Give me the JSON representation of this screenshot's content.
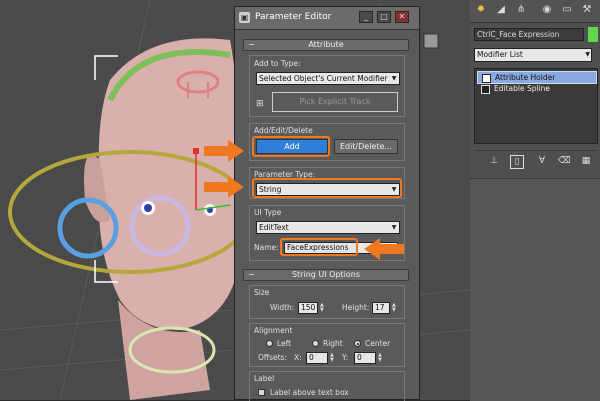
{
  "window": {
    "title": "Parameter Editor",
    "minimize": "_",
    "maximize": "□",
    "close": "✕"
  },
  "attribute": {
    "header": "Attribute",
    "collapse_sign": "−",
    "add_to_type_label": "Add to Type:",
    "add_to_type_value": "Selected Object's Current Modifier",
    "pick_explicit_track": "Pick Explicit Track"
  },
  "add_edit_delete": {
    "label": "Add/Edit/Delete",
    "add_button": "Add",
    "edit_delete_button": "Edit/Delete..."
  },
  "parameter_type": {
    "label": "Parameter Type:",
    "value": "String"
  },
  "ui_type": {
    "label": "UI Type",
    "value": "EditText",
    "name_label": "Name:",
    "name_value": "FaceExpressions"
  },
  "string_ui_options": {
    "header": "String UI Options",
    "collapse_sign": "−",
    "size_label": "Size",
    "width_label": "Width:",
    "width_value": "150",
    "height_label": "Height:",
    "height_value": "17",
    "alignment_label": "Alignment",
    "left": "Left",
    "right": "Right",
    "center": "Center",
    "selected_alignment": "Center",
    "offsets_label": "Offsets:",
    "x_label": "X:",
    "x_value": "0",
    "y_label": "Y:",
    "y_value": "0",
    "label_group": "Label",
    "label_above": "Label above text box"
  },
  "command_panel": {
    "object_name": "CtrlC_Face Expression",
    "object_color": "#5fd84c",
    "modifier_list": "Modifier List",
    "stack": [
      {
        "label": "Attribute Holder",
        "selected": true
      },
      {
        "label": "Editable Spline",
        "selected": false
      }
    ],
    "tab_icons": [
      "sun-icon",
      "modify-icon",
      "hierarchy-icon",
      "motion-icon",
      "display-icon",
      "utilities-icon"
    ],
    "stack_tools": [
      "pin-stack-icon",
      "show-end-result-icon",
      "make-unique-icon",
      "remove-modifier-icon",
      "configure-sets-icon"
    ]
  },
  "colors": {
    "highlight": "#f07820",
    "add_button": "#2f7fd8",
    "selected_row": "#8ca8e0"
  }
}
